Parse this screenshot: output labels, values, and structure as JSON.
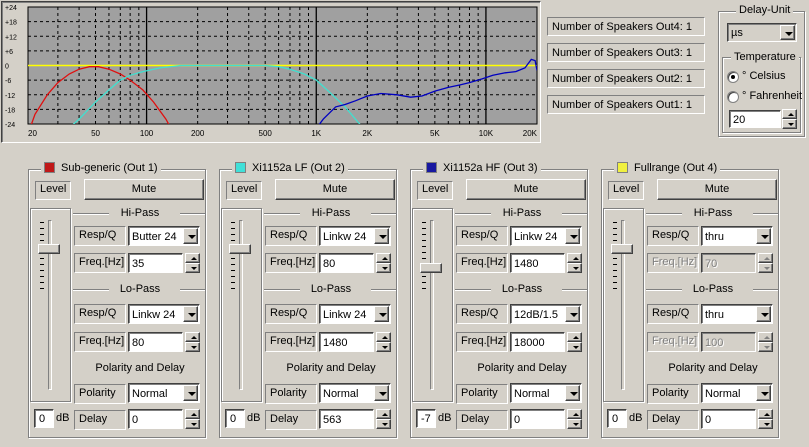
{
  "graph": {
    "y_labels": [
      "+24",
      "+18",
      "+12",
      "+6",
      "0",
      "-6",
      "-12",
      "-18",
      "-24"
    ],
    "x_labels": [
      "20",
      "50",
      "100",
      "200",
      "500",
      "1K",
      "2K",
      "5K",
      "10K",
      "20K"
    ],
    "colors": {
      "bg": "#a0a0a0",
      "zero": "#ffff00",
      "out1": "#e01010",
      "out2": "#40e0d0",
      "out3": "#0000c0",
      "grid": "#000000"
    }
  },
  "speakers": {
    "out4": "Number of Speakers Out4: 1",
    "out3": "Number of Speakers Out3: 1",
    "out2": "Number of Speakers Out2: 1",
    "out1": "Number of Speakers Out1: 1"
  },
  "delay_unit": {
    "title": "Delay-Unit",
    "value": "µs"
  },
  "temperature": {
    "title": "Temperature",
    "celsius": "° Celsius",
    "fahrenheit": "° Fahrenheit",
    "value": "20"
  },
  "channels": [
    {
      "title": "Sub-generic (Out 1)",
      "color": "#c01818",
      "level_label": "Level",
      "mute": "Mute",
      "hipass": "Hi-Pass",
      "resp_label": "Resp/Q",
      "freq_label": "Freq.[Hz]",
      "hp_resp": "Butter 24",
      "hp_freq": "35",
      "lopass": "Lo-Pass",
      "lp_resp": "Linkw 24",
      "lp_freq": "80",
      "pol_title": "Polarity and Delay",
      "polarity_label": "Polarity",
      "polarity": "Normal",
      "delay_label": "Delay",
      "delay": "0",
      "db_value": "0",
      "db_unit": "dB",
      "slider_level": 0
    },
    {
      "title": "Xi1152a LF (Out 2)",
      "color": "#40e0d8",
      "level_label": "Level",
      "mute": "Mute",
      "hipass": "Hi-Pass",
      "resp_label": "Resp/Q",
      "freq_label": "Freq.[Hz]",
      "hp_resp": "Linkw 24",
      "hp_freq": "80",
      "lopass": "Lo-Pass",
      "lp_resp": "Linkw 24",
      "lp_freq": "1480",
      "pol_title": "Polarity and Delay",
      "polarity_label": "Polarity",
      "polarity": "Normal",
      "delay_label": "Delay",
      "delay": "563",
      "db_value": "0",
      "db_unit": "dB",
      "slider_level": 0
    },
    {
      "title": "Xi1152a HF (Out 3)",
      "color": "#1818a0",
      "level_label": "Level",
      "mute": "Mute",
      "hipass": "Hi-Pass",
      "resp_label": "Resp/Q",
      "freq_label": "Freq.[Hz]",
      "hp_resp": "Linkw 24",
      "hp_freq": "1480",
      "lopass": "Lo-Pass",
      "lp_resp": "12dB/1.5",
      "lp_freq": "18000",
      "pol_title": "Polarity and Delay",
      "polarity_label": "Polarity",
      "polarity": "Normal",
      "delay_label": "Delay",
      "delay": "0",
      "db_value": "-7",
      "db_unit": "dB",
      "slider_level": -7
    },
    {
      "title": "Fullrange (Out 4)",
      "color": "#f0f040",
      "level_label": "Level",
      "mute": "Mute",
      "hipass": "Hi-Pass",
      "resp_label": "Resp/Q",
      "freq_label": "Freq.[Hz]",
      "hp_resp": "thru",
      "hp_freq": "70",
      "lopass": "Lo-Pass",
      "lp_resp": "thru",
      "lp_freq": "100",
      "pol_title": "Polarity and Delay",
      "polarity_label": "Polarity",
      "polarity": "Normal",
      "delay_label": "Delay",
      "delay": "0",
      "db_value": "0",
      "db_unit": "dB",
      "slider_level": 0,
      "freq_disabled": true
    }
  ]
}
